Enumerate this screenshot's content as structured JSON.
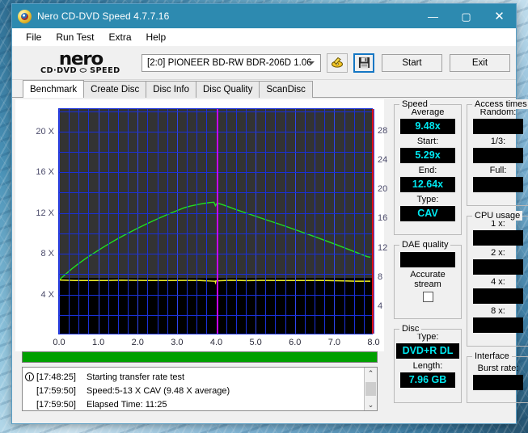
{
  "window": {
    "title": "Nero CD-DVD Speed 4.7.7.16",
    "icon": "nero-disc-icon",
    "minimize": "—",
    "maximize": "▢",
    "close": "✕"
  },
  "menu": {
    "items": [
      "File",
      "Run Test",
      "Extra",
      "Help"
    ]
  },
  "logo": {
    "line1": "nero",
    "line2": "CD·DVD ⬭ SPEED"
  },
  "toolbar": {
    "drive": "[2:0]  PIONEER BD-RW  BDR-206D 1.06",
    "eject_icon": "eject-disc-icon",
    "save_icon": "floppy-save-icon",
    "start_label": "Start",
    "exit_label": "Exit"
  },
  "tabs": [
    {
      "label": "Benchmark",
      "active": true
    },
    {
      "label": "Create Disc",
      "active": false
    },
    {
      "label": "Disc Info",
      "active": false
    },
    {
      "label": "Disc Quality",
      "active": false
    },
    {
      "label": "ScanDisc",
      "active": false
    }
  ],
  "chart_data": {
    "type": "line",
    "title": "",
    "xlabel": "",
    "ylabel": "",
    "xlim": [
      0,
      8
    ],
    "ylim": [
      0,
      22.2
    ],
    "grid": true,
    "left_axis_label_suffix": "X",
    "left_ticks": [
      4,
      8,
      12,
      16,
      20
    ],
    "left_tick_labels": [
      "4 X",
      "8 X",
      "12 X",
      "16 X",
      "20 X"
    ],
    "right_axis_name": "access-time-ms",
    "right_ticks": [
      4,
      8,
      12,
      16,
      20,
      24,
      28
    ],
    "right_tick_labels": [
      "4",
      "8",
      "12",
      "16",
      "20",
      "24",
      "28"
    ],
    "right_ylim": [
      0,
      31
    ],
    "x_ticks": [
      0.0,
      1.0,
      2.0,
      3.0,
      4.0,
      5.0,
      6.0,
      7.0,
      8.0
    ],
    "x_tick_labels": [
      "0.0",
      "1.0",
      "2.0",
      "3.0",
      "4.0",
      "5.0",
      "6.0",
      "7.0",
      "8.0"
    ],
    "markers": [
      {
        "name": "layer-break",
        "x": 4.0,
        "color": "#c800ff"
      },
      {
        "name": "disc-end",
        "x": 7.96,
        "color": "#e01010"
      }
    ],
    "series": [
      {
        "name": "transfer-rate",
        "color": "#22dd22",
        "x": [
          0.0,
          0.16,
          0.32,
          0.48,
          0.64,
          0.8,
          0.96,
          1.12,
          1.28,
          1.44,
          1.6,
          1.76,
          1.92,
          2.08,
          2.24,
          2.4,
          2.56,
          2.72,
          2.88,
          3.04,
          3.2,
          3.36,
          3.52,
          3.68,
          3.84,
          3.96,
          4.0,
          4.04,
          4.2,
          4.36,
          4.52,
          4.68,
          4.84,
          5.0,
          5.16,
          5.32,
          5.48,
          5.64,
          5.8,
          5.96,
          6.12,
          6.28,
          6.44,
          6.6,
          6.76,
          6.92,
          7.08,
          7.24,
          7.4,
          7.56,
          7.72,
          7.88,
          7.96
        ],
        "y": [
          5.29,
          5.85,
          6.38,
          6.86,
          7.31,
          7.73,
          8.13,
          8.52,
          8.89,
          9.25,
          9.59,
          9.92,
          10.24,
          10.55,
          10.85,
          11.14,
          11.42,
          11.69,
          11.95,
          12.2,
          12.44,
          12.61,
          12.74,
          12.86,
          12.95,
          12.99,
          12.64,
          12.92,
          12.72,
          12.5,
          12.27,
          12.06,
          11.85,
          11.64,
          11.43,
          11.22,
          11.02,
          10.81,
          10.6,
          10.38,
          10.16,
          9.94,
          9.72,
          9.5,
          9.27,
          9.04,
          8.81,
          8.57,
          8.33,
          8.09,
          7.85,
          7.61,
          7.55
        ]
      },
      {
        "name": "access-time",
        "color": "#f2f22a",
        "x": [
          0.0,
          0.4,
          0.8,
          1.2,
          1.6,
          2.0,
          2.4,
          2.8,
          3.2,
          3.6,
          3.99,
          4.0,
          4.01,
          4.4,
          4.8,
          5.2,
          5.6,
          6.0,
          6.4,
          6.8,
          7.2,
          7.6,
          7.96
        ],
        "y": [
          5.3,
          5.25,
          5.25,
          5.25,
          5.28,
          5.26,
          5.25,
          5.25,
          5.26,
          5.25,
          5.18,
          5.05,
          5.22,
          5.27,
          5.24,
          5.26,
          5.25,
          5.25,
          5.25,
          5.25,
          5.22,
          5.18,
          5.18
        ]
      }
    ]
  },
  "progress": {
    "percent": 100,
    "color": "#00a000"
  },
  "log": {
    "entries": [
      {
        "icon": "info-icon",
        "time": "[17:48:25]",
        "message": "Starting transfer rate test"
      },
      {
        "icon": "",
        "time": "[17:59:50]",
        "message": "Speed:5-13 X CAV (9.48 X average)"
      },
      {
        "icon": "",
        "time": "[17:59:50]",
        "message": "Elapsed Time: 11:25"
      }
    ],
    "scroll_up": "⌃",
    "scroll_down": "⌄"
  },
  "panels": {
    "speed": {
      "title": "Speed",
      "rows": [
        {
          "label": "Average",
          "value": "9.48x"
        },
        {
          "label": "Start:",
          "value": "5.29x"
        },
        {
          "label": "End:",
          "value": "12.64x"
        },
        {
          "label": "Type:",
          "value": "CAV"
        }
      ]
    },
    "access_times": {
      "title": "Access times",
      "rows": [
        {
          "label": "Random:",
          "value": ""
        },
        {
          "label": "1/3:",
          "value": ""
        },
        {
          "label": "Full:",
          "value": ""
        }
      ]
    },
    "dae_quality": {
      "title": "DAE quality",
      "value": "",
      "checkbox_label_line1": "Accurate",
      "checkbox_label_line2": "stream",
      "checked": false
    },
    "cpu_usage": {
      "title": "CPU usage",
      "rows": [
        {
          "label": "1 x:",
          "value": ""
        },
        {
          "label": "2 x:",
          "value": ""
        },
        {
          "label": "4 x:",
          "value": ""
        },
        {
          "label": "8 x:",
          "value": ""
        }
      ]
    },
    "disc": {
      "title": "Disc",
      "type_label": "Type:",
      "type_value": "DVD+R DL",
      "length_label": "Length:",
      "length_value": "7.96 GB"
    },
    "interface": {
      "title": "Interface",
      "burst_label": "Burst rate:",
      "burst_value": ""
    }
  },
  "colors": {
    "accent": "#2d8ab0",
    "value_text": "#00e8f0",
    "transfer_rate": "#22dd22",
    "access_time": "#f2f22a",
    "grid": "#1a30d8",
    "layer_break": "#c800ff",
    "disc_end": "#e01010",
    "progress": "#00a000"
  }
}
